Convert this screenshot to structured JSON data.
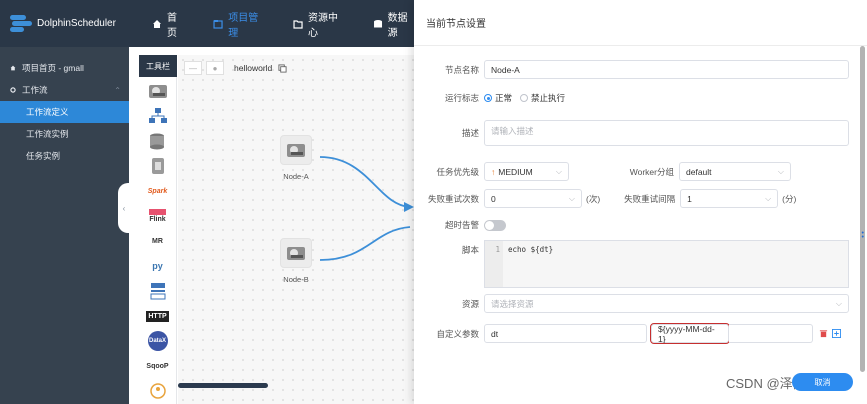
{
  "app": {
    "name": "DolphinScheduler"
  },
  "topnav": [
    {
      "label": "首页",
      "active": false
    },
    {
      "label": "项目管理",
      "active": true
    },
    {
      "label": "资源中心",
      "active": false
    },
    {
      "label": "数据源",
      "active": false
    }
  ],
  "sidebar": {
    "project_label": "项目首页 - gmall",
    "workflow_label": "工作流",
    "items": [
      {
        "label": "工作流定义",
        "active": true
      },
      {
        "label": "工作流实例",
        "active": false
      },
      {
        "label": "任务实例",
        "active": false
      }
    ]
  },
  "toolbox": {
    "title": "工具栏",
    "tools": [
      "shell",
      "sub_process",
      "procedure",
      "sql",
      "spark",
      "flink",
      "mr",
      "python",
      "dependent",
      "http",
      "datax",
      "sqoop",
      "conditions"
    ],
    "tool_labels": {
      "spark": "Spark",
      "flink": "Flink",
      "mr": "MR",
      "python": "py",
      "http": "HTTP",
      "datax": "DataX",
      "sqoop": "SqooP"
    }
  },
  "canvas": {
    "workflow_name": "helloworld",
    "nodes": [
      {
        "label": "Node-A"
      },
      {
        "label": "Node-B"
      }
    ]
  },
  "drawer": {
    "title": "当前节点设置",
    "node_name_label": "节点名称",
    "node_name_value": "Node-A",
    "run_flag_label": "运行标志",
    "run_flag_options": [
      "正常",
      "禁止执行"
    ],
    "description_label": "描述",
    "description_placeholder": "请输入描述",
    "priority_label": "任务优先级",
    "priority_value": "MEDIUM",
    "worker_group_label": "Worker分组",
    "worker_group_value": "default",
    "retry_times_label": "失败重试次数",
    "retry_times_value": "0",
    "retry_times_unit": "(次)",
    "retry_interval_label": "失败重试间隔",
    "retry_interval_value": "1",
    "retry_interval_unit": "(分)",
    "timeout_label": "超时告警",
    "script_label": "脚本",
    "script_line_no": "1",
    "script_code": "echo ${dt}",
    "resource_label": "资源",
    "resource_placeholder": "请选择资源",
    "custom_params_label": "自定义参数",
    "custom_param_prop": "dt",
    "custom_param_value": "${yyyy-MM-dd-1}"
  },
  "footer": {
    "watermark": "CSDN @泽西L",
    "fab_label": "取消"
  },
  "colors": {
    "topbar": "#2a3747",
    "sidebar": "#36424f",
    "accent": "#2d8cf0",
    "highlight_border": "#c62f2f",
    "edge": "#3d8fd8"
  }
}
